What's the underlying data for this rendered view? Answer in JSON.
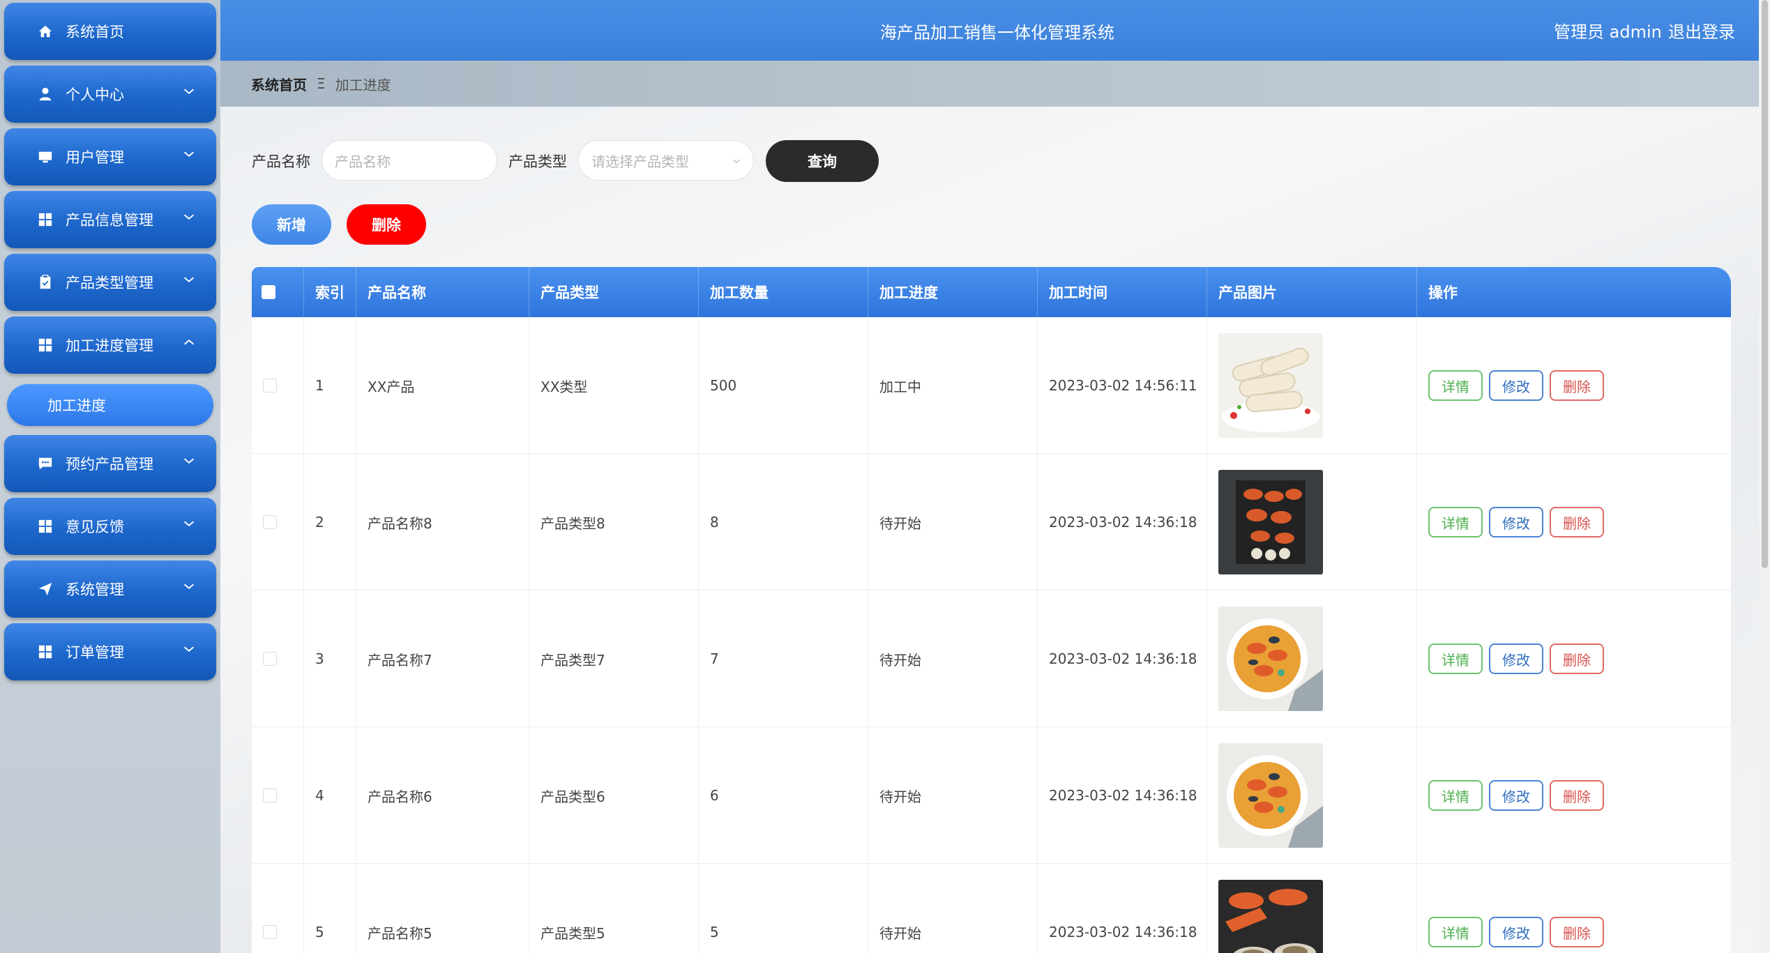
{
  "header": {
    "title": "海产品加工销售一体化管理系统",
    "user": "管理员 admin",
    "logout": "退出登录"
  },
  "sidebar": {
    "items": [
      {
        "label": "系统首页",
        "icon": "home-icon",
        "expandable": false
      },
      {
        "label": "个人中心",
        "icon": "person-icon",
        "expandable": true
      },
      {
        "label": "用户管理",
        "icon": "monitor-icon",
        "expandable": true
      },
      {
        "label": "产品信息管理",
        "icon": "grid-icon",
        "expandable": true
      },
      {
        "label": "产品类型管理",
        "icon": "clipboard-icon",
        "expandable": true
      },
      {
        "label": "加工进度管理",
        "icon": "grid-icon",
        "expandable": true,
        "expanded": true
      },
      {
        "label": "预约产品管理",
        "icon": "chat-icon",
        "expandable": true
      },
      {
        "label": "意见反馈",
        "icon": "grid-icon",
        "expandable": true
      },
      {
        "label": "系统管理",
        "icon": "send-icon",
        "expandable": true
      },
      {
        "label": "订单管理",
        "icon": "grid-icon",
        "expandable": true
      }
    ],
    "active_sub": "加工进度"
  },
  "breadcrumb": {
    "home": "系统首页",
    "separator": "Ξ",
    "current": "加工进度"
  },
  "search": {
    "name_label": "产品名称",
    "name_placeholder": "产品名称",
    "type_label": "产品类型",
    "type_placeholder": "请选择产品类型",
    "query_button": "查询"
  },
  "actions": {
    "add": "新增",
    "delete": "删除"
  },
  "table": {
    "columns": [
      "索引",
      "产品名称",
      "产品类型",
      "加工数量",
      "加工进度",
      "加工时间",
      "产品图片",
      "操作"
    ],
    "row_actions": {
      "detail": "详情",
      "edit": "修改",
      "delete": "删除"
    },
    "rows": [
      {
        "index": "1",
        "name": "XX产品",
        "type": "XX类型",
        "qty": "500",
        "progress": "加工中",
        "time": "2023-03-02 14:56:11"
      },
      {
        "index": "2",
        "name": "产品名称8",
        "type": "产品类型8",
        "qty": "8",
        "progress": "待开始",
        "time": "2023-03-02 14:36:18"
      },
      {
        "index": "3",
        "name": "产品名称7",
        "type": "产品类型7",
        "qty": "7",
        "progress": "待开始",
        "time": "2023-03-02 14:36:18"
      },
      {
        "index": "4",
        "name": "产品名称6",
        "type": "产品类型6",
        "qty": "6",
        "progress": "待开始",
        "time": "2023-03-02 14:36:18"
      },
      {
        "index": "5",
        "name": "产品名称5",
        "type": "产品类型5",
        "qty": "5",
        "progress": "待开始",
        "time": "2023-03-02 14:36:18"
      }
    ]
  },
  "colors": {
    "primary": "#3a7fda",
    "add_button": "#4a90ef",
    "delete_button": "#ff0000",
    "query_button": "#2b2b2b"
  }
}
